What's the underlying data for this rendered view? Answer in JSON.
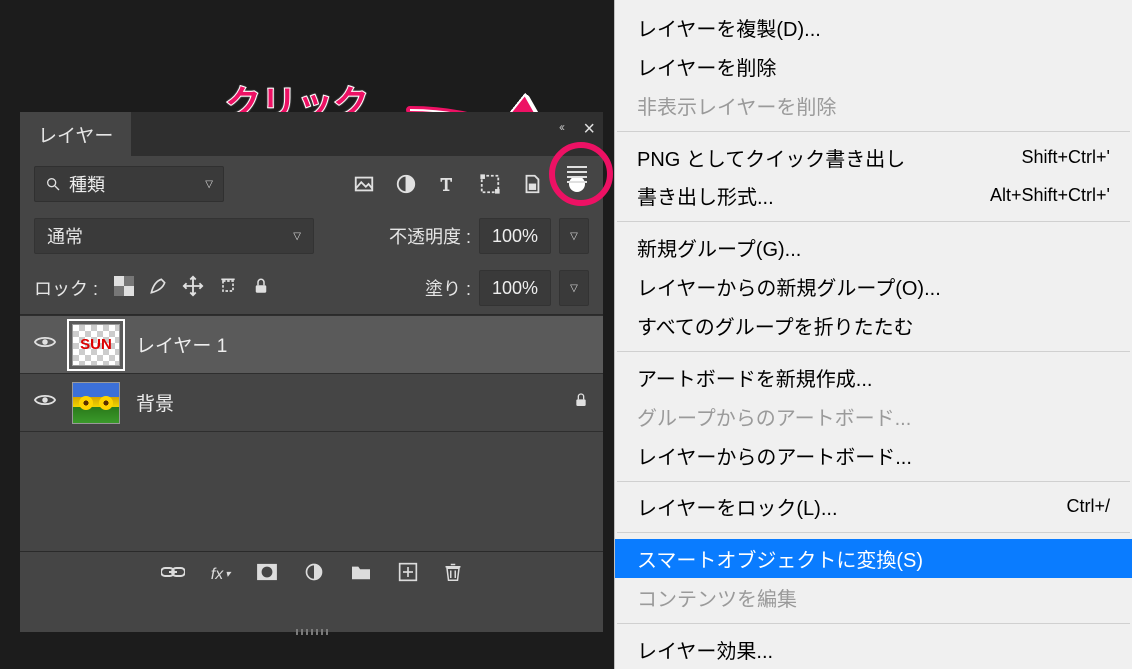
{
  "annotation": {
    "text": "クリック"
  },
  "panel": {
    "tab_title": "レイヤー",
    "filter_label": "種類",
    "blend_mode": "通常",
    "opacity_label": "不透明度 :",
    "opacity_value": "100%",
    "lock_label": "ロック :",
    "fill_label": "塗り :",
    "fill_value": "100%",
    "layers": [
      {
        "name": "レイヤー 1",
        "thumb_text": "SUN",
        "selected": true,
        "locked": false
      },
      {
        "name": "背景",
        "thumb_text": "",
        "selected": false,
        "locked": true
      }
    ],
    "footer_fx": "fx"
  },
  "menu": {
    "items": [
      {
        "label": "レイヤーを複製(D)...",
        "shortcut": "",
        "disabled": false
      },
      {
        "label": "レイヤーを削除",
        "shortcut": "",
        "disabled": false
      },
      {
        "label": "非表示レイヤーを削除",
        "shortcut": "",
        "disabled": true
      },
      {
        "sep": true
      },
      {
        "label": "PNG としてクイック書き出し",
        "shortcut": "Shift+Ctrl+'",
        "disabled": false
      },
      {
        "label": "書き出し形式...",
        "shortcut": "Alt+Shift+Ctrl+'",
        "disabled": false
      },
      {
        "sep": true
      },
      {
        "label": "新規グループ(G)...",
        "shortcut": "",
        "disabled": false
      },
      {
        "label": "レイヤーからの新規グループ(O)...",
        "shortcut": "",
        "disabled": false
      },
      {
        "label": "すべてのグループを折りたたむ",
        "shortcut": "",
        "disabled": false
      },
      {
        "sep": true
      },
      {
        "label": "アートボードを新規作成...",
        "shortcut": "",
        "disabled": false
      },
      {
        "label": "グループからのアートボード...",
        "shortcut": "",
        "disabled": true
      },
      {
        "label": "レイヤーからのアートボード...",
        "shortcut": "",
        "disabled": false
      },
      {
        "sep": true
      },
      {
        "label": "レイヤーをロック(L)...",
        "shortcut": "Ctrl+/",
        "disabled": false
      },
      {
        "sep": true
      },
      {
        "label": "スマートオブジェクトに変換(S)",
        "shortcut": "",
        "disabled": false,
        "highlighted": true
      },
      {
        "label": "コンテンツを編集",
        "shortcut": "",
        "disabled": true
      },
      {
        "sep": true
      },
      {
        "label": "レイヤー効果...",
        "shortcut": "",
        "disabled": false
      }
    ]
  }
}
